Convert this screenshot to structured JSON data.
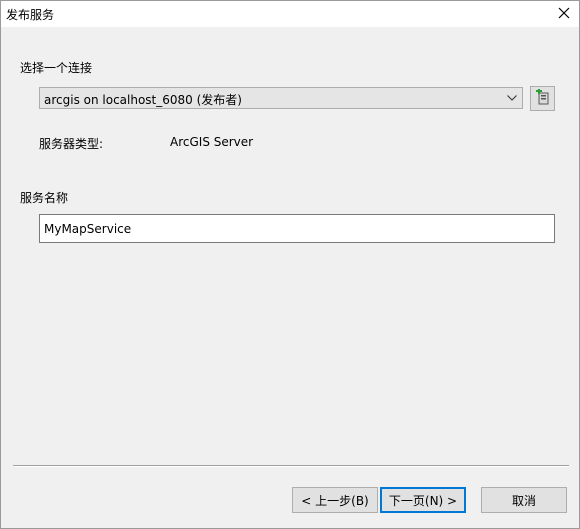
{
  "window": {
    "title": "发布服务"
  },
  "connection": {
    "section_label": "选择一个连接",
    "selected": "arcgis on localhost_6080 (发布者)",
    "server_type_label": "服务器类型:",
    "server_type_value": "ArcGIS Server"
  },
  "service": {
    "section_label": "服务名称",
    "name_value": "MyMapService"
  },
  "buttons": {
    "back": "< 上一步(B)",
    "next": "下一页(N) >",
    "cancel": "取消"
  }
}
